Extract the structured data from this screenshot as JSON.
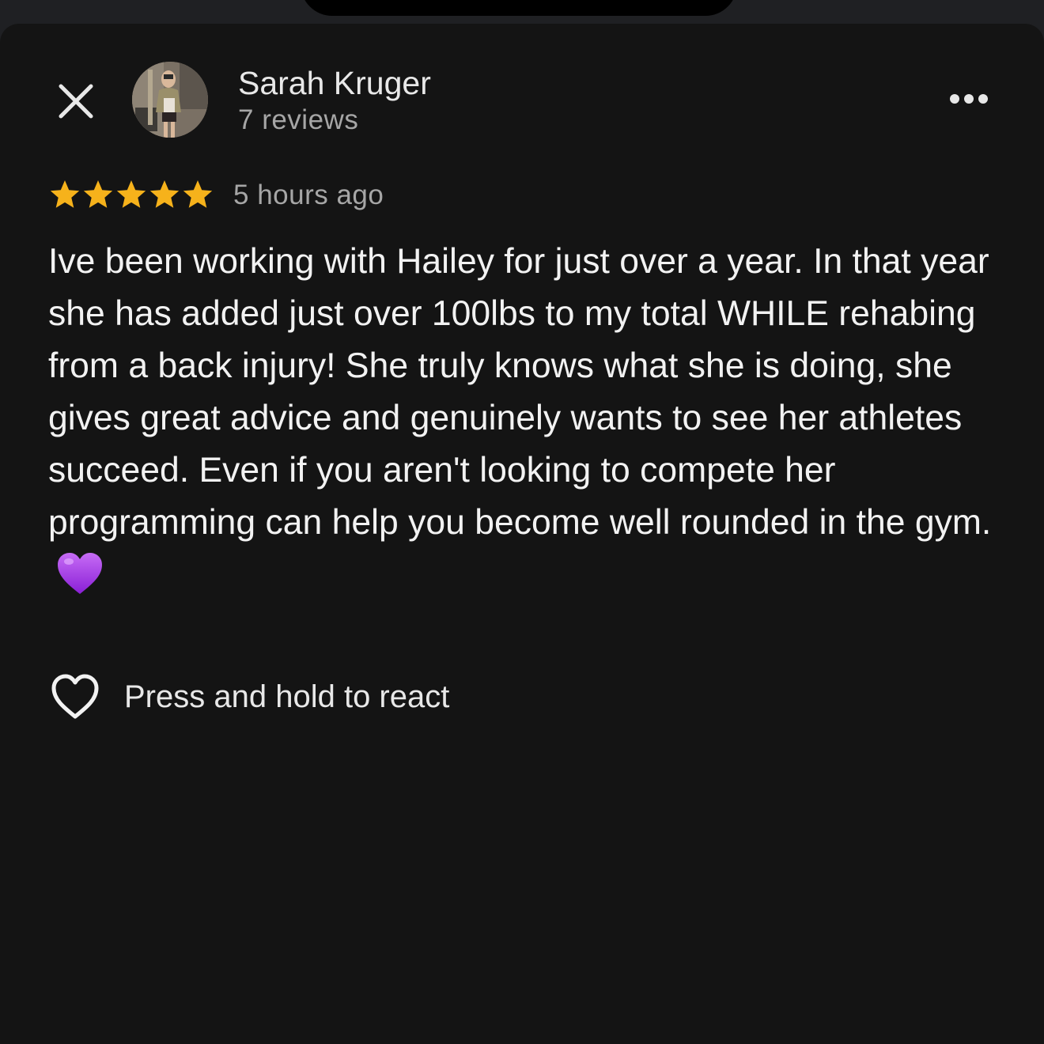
{
  "review": {
    "author_name": "Sarah Kruger",
    "review_count": "7 reviews",
    "rating": 5,
    "rating_max": 5,
    "timestamp": "5 hours ago",
    "text": "Ive been working with Hailey for just over a year. In that year she has added just over 100lbs to my total WHILE rehabing from a back injury! She truly knows what she is doing, she gives great advice and genuinely wants to see her athletes succeed. Even if you aren't looking to compete her programming can help you become well rounded in the gym.",
    "emoji": "purple-heart-emoji"
  },
  "actions": {
    "react_label": "Press and hold to react"
  },
  "icons": {
    "close": "close-icon",
    "more": "more-horizontal-icon",
    "star": "star-icon",
    "react": "heart-outline-icon"
  },
  "colors": {
    "background": "#141414",
    "star": "#f6b21b",
    "primary_text": "#f2f2f2",
    "secondary_text": "#a6a6a6",
    "emoji": "#a23ee6"
  }
}
